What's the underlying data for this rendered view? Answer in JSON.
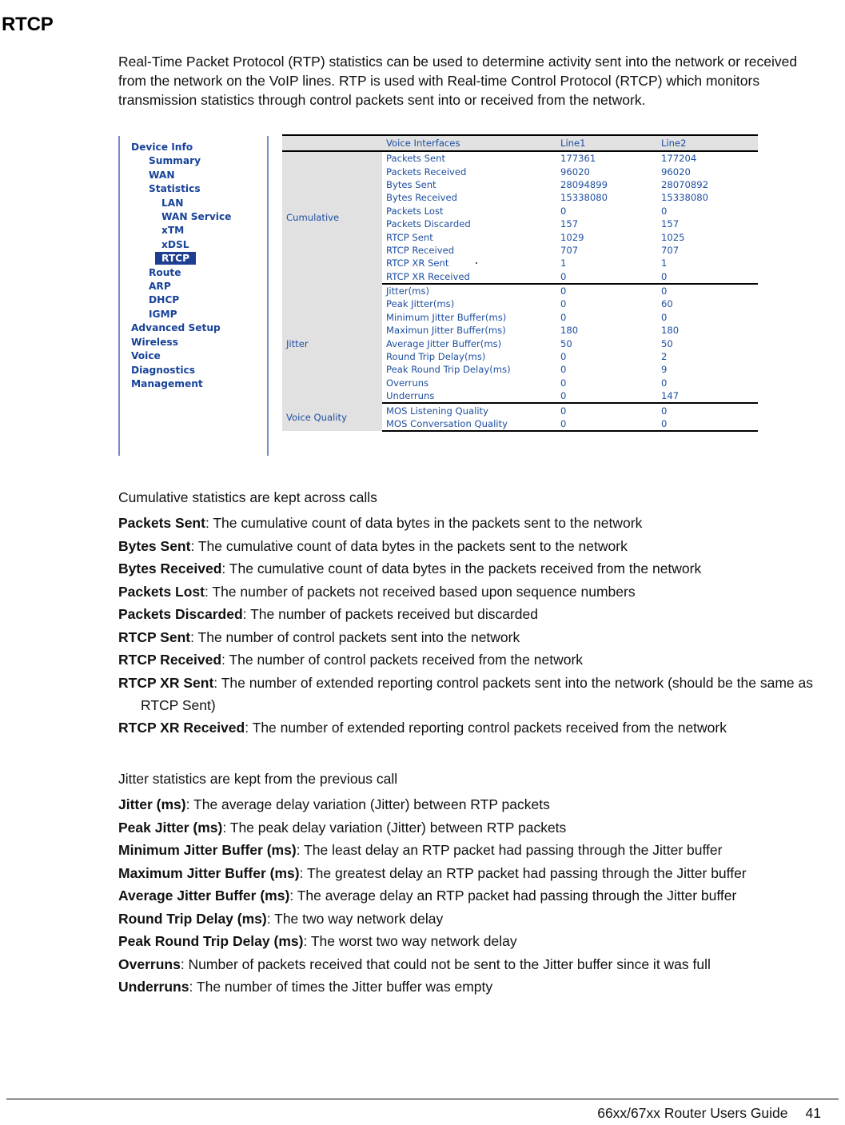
{
  "page": {
    "title": "RTCP",
    "intro": "Real-Time Packet Protocol (RTP) statistics can be used to determine activity sent into the network or received from the network on the VoIP lines. RTP is used with Real-time Control Protocol (RTCP) which monitors transmission statistics through control packets sent into or received from the network.",
    "lede_cumulative": "Cumulative statistics are kept across calls",
    "lede_jitter": "Jitter statistics are kept from the previous call"
  },
  "footer": {
    "guide": "66xx/67xx Router Users Guide",
    "page_number": "41"
  },
  "router_ui": {
    "nav": {
      "items": [
        {
          "label": "Device Info",
          "level": 1,
          "selected": false
        },
        {
          "label": "Summary",
          "level": 2,
          "selected": false
        },
        {
          "label": "WAN",
          "level": 2,
          "selected": false
        },
        {
          "label": "Statistics",
          "level": 2,
          "selected": false
        },
        {
          "label": "LAN",
          "level": 3,
          "selected": false
        },
        {
          "label": "WAN Service",
          "level": 3,
          "selected": false
        },
        {
          "label": "xTM",
          "level": 3,
          "selected": false
        },
        {
          "label": "xDSL",
          "level": 3,
          "selected": false
        },
        {
          "label": "RTCP",
          "level": 3,
          "selected": true
        },
        {
          "label": "Route",
          "level": 2,
          "selected": false
        },
        {
          "label": "ARP",
          "level": 2,
          "selected": false
        },
        {
          "label": "DHCP",
          "level": 2,
          "selected": false
        },
        {
          "label": "IGMP",
          "level": 2,
          "selected": false
        },
        {
          "label": "Advanced Setup",
          "level": 1,
          "selected": false
        },
        {
          "label": "Wireless",
          "level": 1,
          "selected": false
        },
        {
          "label": "Voice",
          "level": 1,
          "selected": false
        },
        {
          "label": "Diagnostics",
          "level": 1,
          "selected": false
        },
        {
          "label": "Management",
          "level": 1,
          "selected": false
        }
      ],
      "selected_color": "#1E3F91",
      "text_color": "#18439A"
    },
    "table": {
      "headers": [
        "",
        "Voice Interfaces",
        "Line1",
        "Line2"
      ],
      "groups": [
        {
          "name": "Cumulative",
          "rows": [
            {
              "metric": "Packets Sent",
              "line1": "177361",
              "line2": "177204"
            },
            {
              "metric": "Packets Received",
              "line1": "96020",
              "line2": "96020"
            },
            {
              "metric": "Bytes Sent",
              "line1": "28094899",
              "line2": "28070892"
            },
            {
              "metric": "Bytes Received",
              "line1": "15338080",
              "line2": "15338080"
            },
            {
              "metric": "Packets Lost",
              "line1": "0",
              "line2": "0"
            },
            {
              "metric": "Packets Discarded",
              "line1": "157",
              "line2": "157"
            },
            {
              "metric": "RTCP Sent",
              "line1": "1029",
              "line2": "1025"
            },
            {
              "metric": "RTCP Received",
              "line1": "707",
              "line2": "707"
            },
            {
              "metric": "RTCP XR Sent",
              "line1": "1",
              "line2": "1"
            },
            {
              "metric": "RTCP XR Received",
              "line1": "0",
              "line2": "0"
            }
          ]
        },
        {
          "name": "Jitter",
          "rows": [
            {
              "metric": "Jitter(ms)",
              "line1": "0",
              "line2": "0"
            },
            {
              "metric": "Peak Jitter(ms)",
              "line1": "0",
              "line2": "60"
            },
            {
              "metric": "Minimum Jitter Buffer(ms)",
              "line1": "0",
              "line2": "0"
            },
            {
              "metric": "Maximun Jitter Buffer(ms)",
              "line1": "180",
              "line2": "180"
            },
            {
              "metric": "Average Jitter Buffer(ms)",
              "line1": "50",
              "line2": "50"
            },
            {
              "metric": "Round Trip Delay(ms)",
              "line1": "0",
              "line2": "2"
            },
            {
              "metric": "Peak Round Trip Delay(ms)",
              "line1": "0",
              "line2": "9"
            },
            {
              "metric": "Overruns",
              "line1": "0",
              "line2": "0"
            },
            {
              "metric": "Underruns",
              "line1": "0",
              "line2": "147"
            }
          ]
        },
        {
          "name": "Voice Quality",
          "rows": [
            {
              "metric": "MOS Listening Quality",
              "line1": "0",
              "line2": "0"
            },
            {
              "metric": "MOS Conversation Quality",
              "line1": "0",
              "line2": "0"
            }
          ]
        }
      ]
    }
  },
  "definitions_cumulative": [
    {
      "term": "Packets Sent",
      "desc": ": The cumulative count of data bytes in the packets sent to the network"
    },
    {
      "term": "Bytes Sent",
      "desc": ": The cumulative count of data bytes in the packets sent to the network"
    },
    {
      "term": "Bytes Received",
      "desc": ": The cumulative count of data bytes in the packets received from the network"
    },
    {
      "term": "Packets Lost",
      "desc": ": The number of packets not received based upon sequence numbers"
    },
    {
      "term": "Packets Discarded",
      "desc": ": The number of packets received but discarded"
    },
    {
      "term": "RTCP Sent",
      "desc": ": The number of control packets sent into the network"
    },
    {
      "term": "RTCP Received",
      "desc": ": The number of control packets received from the network"
    },
    {
      "term": "RTCP XR Sent",
      "desc": ": The number of extended reporting control packets sent into the network (should be the same as RTCP Sent)"
    },
    {
      "term": "RTCP XR Received",
      "desc": ": The number of extended reporting control packets received from the network"
    }
  ],
  "definitions_jitter": [
    {
      "term": "Jitter (ms)",
      "desc": ": The average delay variation (Jitter) between RTP packets"
    },
    {
      "term": "Peak Jitter (ms)",
      "desc": ": The peak delay variation (Jitter) between RTP packets"
    },
    {
      "term": "Minimum Jitter Buffer (ms)",
      "desc": ": The least delay an RTP packet had passing through the Jitter buffer"
    },
    {
      "term": "Maximum Jitter Buffer (ms)",
      "desc": ": The greatest delay an RTP packet had passing through the Jitter buffer"
    },
    {
      "term": "Average Jitter Buffer (ms)",
      "desc": ": The average delay an RTP packet had passing through the Jitter buffer"
    },
    {
      "term": "Round Trip Delay (ms)",
      "desc": ": The two way network delay"
    },
    {
      "term": "Peak Round Trip Delay (ms)",
      "desc": ": The worst two way network delay"
    },
    {
      "term": "Overruns",
      "desc": ": Number of packets received that could not be sent to the Jitter buffer since it was full"
    },
    {
      "term": "Underruns",
      "desc": ": The number of times the Jitter buffer was empty"
    }
  ]
}
